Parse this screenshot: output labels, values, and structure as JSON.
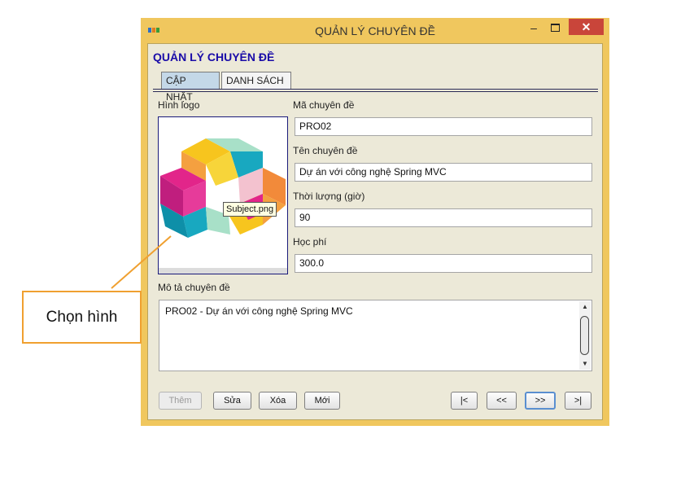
{
  "window": {
    "title": "QUẢN LÝ CHUYÊN ĐỀ",
    "min_symbol": "–",
    "close_symbol": "✕"
  },
  "form": {
    "heading": "QUẢN LÝ CHUYÊN ĐỀ",
    "tabs": [
      {
        "label": "CẬP NHẬT",
        "active": true
      },
      {
        "label": "DANH SÁCH",
        "active": false
      }
    ],
    "logo_label": "Hình logo",
    "logo_tooltip": "Subject.png",
    "fields": {
      "ma": {
        "label": "Mã chuyên đề",
        "value": "PRO02"
      },
      "ten": {
        "label": "Tên chuyên đề",
        "value": "Dự án với công nghệ Spring MVC"
      },
      "thoiluong": {
        "label": "Thời lượng (giờ)",
        "value": "90"
      },
      "hocphi": {
        "label": "Học phí",
        "value": "300.0"
      }
    },
    "mota": {
      "label": "Mô tả chuyên đề",
      "value": "PRO02 - Dự án với công nghệ Spring MVC"
    },
    "buttons": {
      "them": "Thêm",
      "sua": "Sửa",
      "xoa": "Xóa",
      "moi": "Mới",
      "first": "|<",
      "prev": "<<",
      "next": ">>",
      "last": ">|"
    }
  },
  "annotation": {
    "callout": "Chọn hình",
    "color": "#f0a030"
  },
  "colors": {
    "window_frame": "#f0c75e",
    "heading": "#1a0ca8",
    "close_button": "#c9453a"
  }
}
